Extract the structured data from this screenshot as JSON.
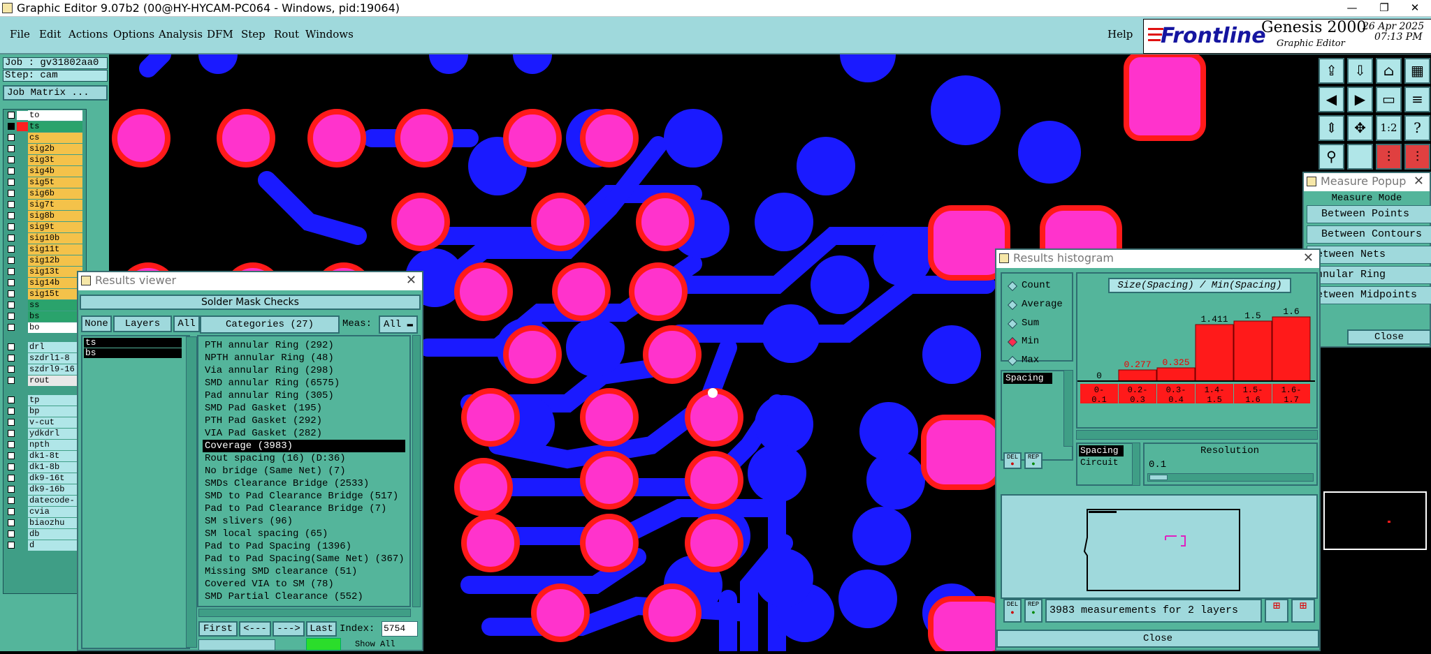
{
  "window": {
    "title": "Graphic Editor 9.07b2 (00@HY-HYCAM-PC064 - Windows, pid:19064)",
    "btn_min": "—",
    "btn_restore": "❐",
    "btn_close": "✕"
  },
  "menu": [
    "File",
    "Edit",
    "Actions",
    "Options",
    "Analysis",
    "DFM",
    "Step",
    "Rout",
    "Windows"
  ],
  "help": "Help",
  "brand": {
    "logo": "Frontline",
    "product": "Genesis 2000",
    "subtitle": "Graphic Editor",
    "date": "26 Apr 2025",
    "time": "07:13 PM"
  },
  "job": {
    "job": "Job : gv31802aa0",
    "step": "Step: cam",
    "matrix_btn": "Job Matrix ..."
  },
  "layers_top": [
    {
      "name": "to",
      "color": "#ffffff",
      "check": false,
      "bg": "#ffffff"
    },
    {
      "name": "ts",
      "color": "#ff2020",
      "check": true,
      "bg": "#2aa36c"
    },
    {
      "name": "cs",
      "color": "",
      "check": false,
      "bg": "#f4c24a"
    },
    {
      "name": "sig2b",
      "color": "",
      "check": false,
      "bg": "#f4c24a"
    },
    {
      "name": "sig3t",
      "color": "",
      "check": false,
      "bg": "#f4c24a"
    },
    {
      "name": "sig4b",
      "color": "",
      "check": false,
      "bg": "#f4c24a"
    },
    {
      "name": "sig5t",
      "color": "",
      "check": false,
      "bg": "#f4c24a"
    },
    {
      "name": "sig6b",
      "color": "",
      "check": false,
      "bg": "#f4c24a"
    },
    {
      "name": "sig7t",
      "color": "",
      "check": false,
      "bg": "#f4c24a"
    },
    {
      "name": "sig8b",
      "color": "",
      "check": false,
      "bg": "#f4c24a"
    },
    {
      "name": "sig9t",
      "color": "",
      "check": false,
      "bg": "#f4c24a"
    },
    {
      "name": "sig10b",
      "color": "",
      "check": false,
      "bg": "#f4c24a"
    },
    {
      "name": "sig11t",
      "color": "",
      "check": false,
      "bg": "#f4c24a"
    },
    {
      "name": "sig12b",
      "color": "",
      "check": false,
      "bg": "#f4c24a"
    },
    {
      "name": "sig13t",
      "color": "",
      "check": false,
      "bg": "#f4c24a"
    },
    {
      "name": "sig14b",
      "color": "",
      "check": false,
      "bg": "#f4c24a"
    },
    {
      "name": "sig15t",
      "color": "",
      "check": false,
      "bg": "#f4c24a"
    },
    {
      "name": "ss",
      "color": "",
      "check": false,
      "bg": "#2aa36c"
    },
    {
      "name": "bs",
      "color": "",
      "check": false,
      "bg": "#2aa36c"
    },
    {
      "name": "bo",
      "color": "",
      "check": false,
      "bg": "#ffffff"
    }
  ],
  "layers_drill": [
    {
      "name": "drl",
      "bg": "#b0e6e8"
    },
    {
      "name": "szdrl1-8",
      "bg": "#b0e6e8"
    },
    {
      "name": "szdrl9-16",
      "bg": "#b0e6e8"
    },
    {
      "name": "rout",
      "bg": "#e8e8e8"
    }
  ],
  "layers_other": [
    "tp",
    "bp",
    "v-cut",
    "ydkdrl",
    "npth",
    "dk1-8t",
    "dk1-8b",
    "dk9-16t",
    "dk9-16b",
    "datecode-",
    "cvia",
    "biaozhu",
    "db",
    "d"
  ],
  "results_viewer": {
    "title": "Results viewer",
    "heading": "Solder Mask Checks",
    "none_btn": "None",
    "layers_label": "Layers",
    "all_btn": "All",
    "layers": [
      "ts",
      "bs"
    ],
    "categories_label": "Categories (27)",
    "meas_label": "Meas:",
    "meas_value": "All",
    "categories": [
      "PTH annular Ring (292)",
      "NPTH annular Ring (48)",
      "Via annular Ring (298)",
      "SMD annular Ring (6575)",
      "Pad annular Ring (305)",
      "SMD Pad Gasket (195)",
      "PTH Pad Gasket (292)",
      "VIA Pad Gasket (282)",
      "Coverage (3983)",
      "Rout spacing (16)         (D:36)",
      "No bridge (Same Net) (7)",
      "SMDs Clearance Bridge (2533)",
      "SMD to Pad Clearance Bridge (517)",
      "Pad to Pad Clearance Bridge (7)",
      "SM slivers (96)",
      "SM local spacing (65)",
      "Pad to Pad Spacing (1396)",
      "Pad to Pad Spacing(Same Net) (367)",
      "Missing SMD clearance (51)",
      "Covered VIA to SM (78)",
      "SMD Partial Clearance (552)"
    ],
    "selected_index": 8,
    "first_btn": "First",
    "prev_btn": "<---",
    "next_btn": "--->",
    "last_btn": "Last",
    "index_label": "Index:",
    "index_value": "5754",
    "show_all": "Show All"
  },
  "histogram": {
    "title": "Results histogram",
    "modes": [
      "Count",
      "Average",
      "Sum",
      "Min",
      "Max"
    ],
    "selected_mode": "Min",
    "chart_title": "Size(Spacing) / Min(Spacing)",
    "list_sel": "Spacing",
    "del_btn": "DEL",
    "rep_btn": "REP",
    "attrs": [
      "Spacing",
      "Circuit"
    ],
    "resolution_label": "Resolution",
    "resolution_value": "0.1",
    "status": "3983 measurements for 2 layers",
    "close_btn": "Close"
  },
  "chart_data": {
    "type": "bar",
    "title": "Size(Spacing) / Min(Spacing)",
    "categories": [
      "0-0.1",
      "0.2-0.3",
      "0.3-0.4",
      "1.4-1.5",
      "1.5-1.6",
      "1.6-1.7"
    ],
    "values": [
      0,
      0.277,
      0.325,
      1.411,
      1.5,
      1.6
    ],
    "value_labels": [
      "0",
      "0.277",
      "0.325",
      "1.411",
      "1.5",
      "1.6"
    ],
    "bin_labels_top": [
      "0-",
      "0.2-",
      "0.3-",
      "1.4-",
      "1.5-",
      "1.6-"
    ],
    "bin_labels_bottom": [
      "0.1",
      "0.3",
      "0.4",
      "1.5",
      "1.6",
      "1.7"
    ],
    "ylim": [
      0,
      1.6
    ],
    "color": "#ff1a1a"
  },
  "measure": {
    "title": "Measure Popup",
    "mode_label": "Measure Mode",
    "modes": [
      "Between Points",
      "Between Contours",
      "Between Nets",
      "Annular Ring",
      "Between Midpoints"
    ],
    "close_btn": "Close"
  },
  "colors": {
    "pad": "#ff33cc",
    "copper": "#1a1aff",
    "mask": "#ff1a1a",
    "panel": "#54b59b",
    "panel_light": "#9fd9dc"
  },
  "icons": [
    "frontline-logo",
    "app-icon",
    "window-icon"
  ]
}
